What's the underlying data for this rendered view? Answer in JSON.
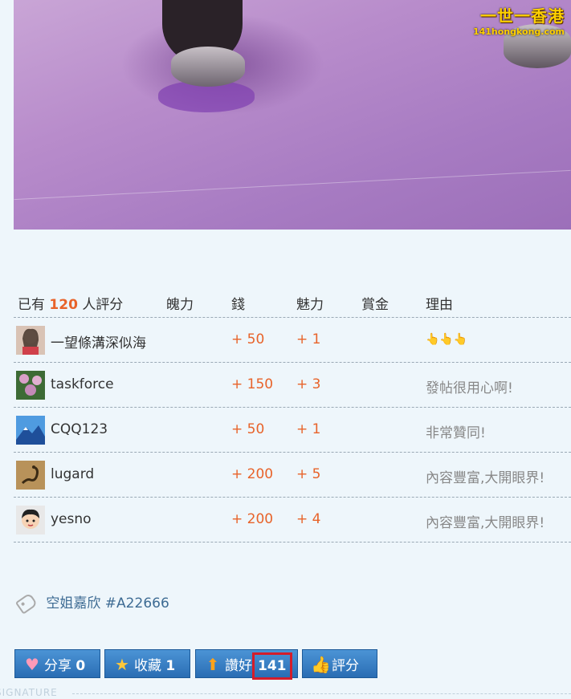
{
  "watermark": {
    "main": "一世一香港",
    "sub": "141hongkong.com"
  },
  "rating": {
    "header": {
      "prefix": "已有",
      "count": "120",
      "suffix": "人評分",
      "cols": [
        "魄力",
        "錢",
        "魅力",
        "賞金",
        "理由"
      ]
    },
    "rows": [
      {
        "user": "一望條溝深似海",
        "money": "+ 50",
        "charm": "+ 1",
        "reason": "👆👆👆",
        "avatar": "girl-avatar"
      },
      {
        "user": "taskforce",
        "money": "+ 150",
        "charm": "+ 3",
        "reason": "發帖很用心啊!",
        "avatar": "flower-avatar"
      },
      {
        "user": "CQQ123",
        "money": "+ 50",
        "charm": "+ 1",
        "reason": "非常贊同!",
        "avatar": "mountain-avatar"
      },
      {
        "user": "lugard",
        "money": "+ 200",
        "charm": "+ 5",
        "reason": "內容豐富,大開眼界!",
        "avatar": "scorpion-avatar"
      },
      {
        "user": "yesno",
        "money": "+ 200",
        "charm": "+ 4",
        "reason": "內容豐富,大開眼界!",
        "avatar": "cartoon-avatar"
      }
    ]
  },
  "tag": {
    "text": "空姐嘉欣 #A22666"
  },
  "buttons": {
    "share": {
      "label": "分享",
      "count": "0"
    },
    "favorite": {
      "label": "收藏",
      "count": "1"
    },
    "like": {
      "label": "讚好",
      "count": "141"
    },
    "rate": {
      "label": "評分"
    }
  },
  "signature": {
    "label": "SIGNATURE"
  }
}
